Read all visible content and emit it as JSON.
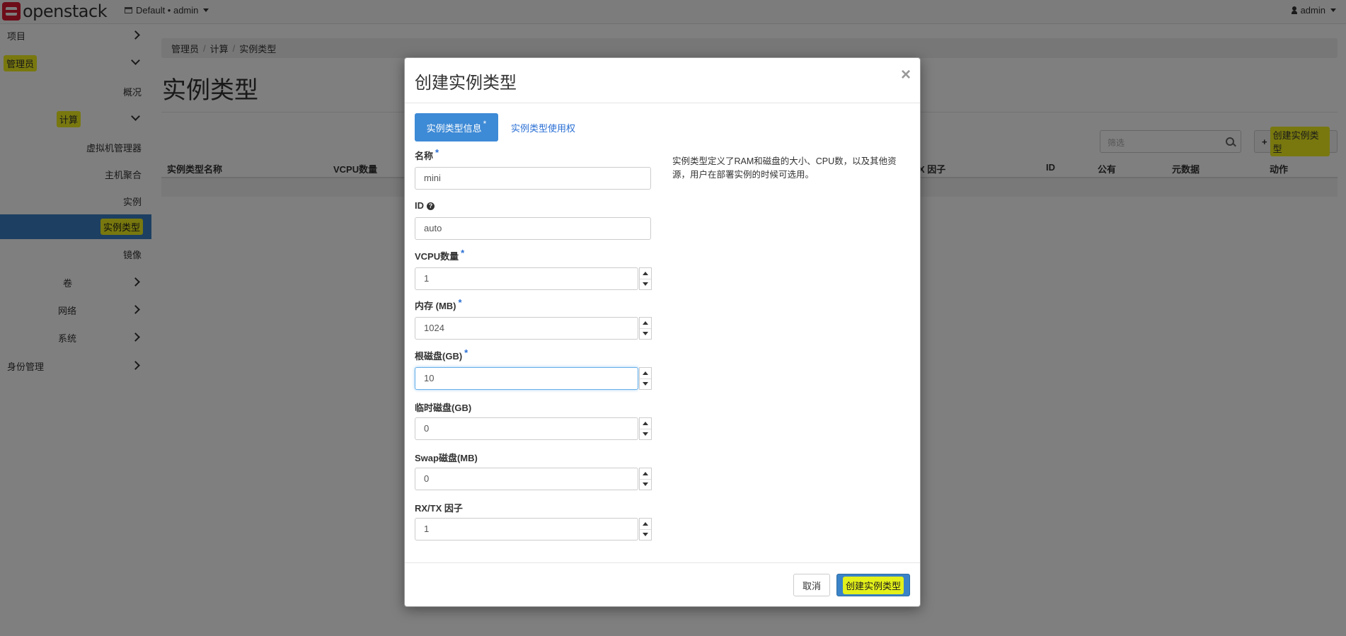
{
  "navbar": {
    "brand": "openstack",
    "project_picker": "Default • admin",
    "user": "admin"
  },
  "sidebar": {
    "items": [
      {
        "label": "项目"
      },
      {
        "label": "管理员"
      },
      {
        "label": "概况"
      },
      {
        "label": "计算"
      },
      {
        "label": "虚拟机管理器"
      },
      {
        "label": "主机聚合"
      },
      {
        "label": "实例"
      },
      {
        "label": "实例类型"
      },
      {
        "label": "镜像"
      },
      {
        "label": "卷"
      },
      {
        "label": "网络"
      },
      {
        "label": "系统"
      },
      {
        "label": "身份管理"
      }
    ]
  },
  "breadcrumb": [
    "管理员",
    "计算",
    "实例类型"
  ],
  "page": {
    "title": "实例类型",
    "filter_placeholder": "筛选",
    "create_button": "创建实例类型"
  },
  "table": {
    "columns": [
      "实例类型名称",
      "VCPU数量",
      "X 因子",
      "ID",
      "公有",
      "元数据",
      "动作"
    ]
  },
  "modal": {
    "title": "创建实例类型",
    "close": "×",
    "tabs": {
      "active": "实例类型信息",
      "required_mark": "*",
      "access": "实例类型使用权"
    },
    "fields": {
      "name": {
        "label": "名称",
        "required": "*",
        "value": "mini"
      },
      "id": {
        "label": "ID",
        "help": "?",
        "value": "auto"
      },
      "vcpus": {
        "label": "VCPU数量",
        "required": "*",
        "value": "1"
      },
      "ram": {
        "label": "内存 (MB)",
        "required": "*",
        "value": "1024"
      },
      "root_disk": {
        "label": "根磁盘(GB)",
        "required": "*",
        "value": "10"
      },
      "ephemeral": {
        "label": "临时磁盘(GB)",
        "value": "0"
      },
      "swap": {
        "label": "Swap磁盘(MB)",
        "value": "0"
      },
      "rxtx": {
        "label": "RX/TX 因子",
        "value": "1"
      }
    },
    "help_text": "实例类型定义了RAM和磁盘的大小、CPU数，以及其他资源，用户在部署实例的时候可选用。",
    "cancel_button": "取消",
    "submit_button": "创建实例类型"
  },
  "colors": {
    "primary": "#3a83c8",
    "highlight": "#f0f01e",
    "active_sidebar": "#3a7fc4",
    "brand_red": "#da1a32"
  }
}
